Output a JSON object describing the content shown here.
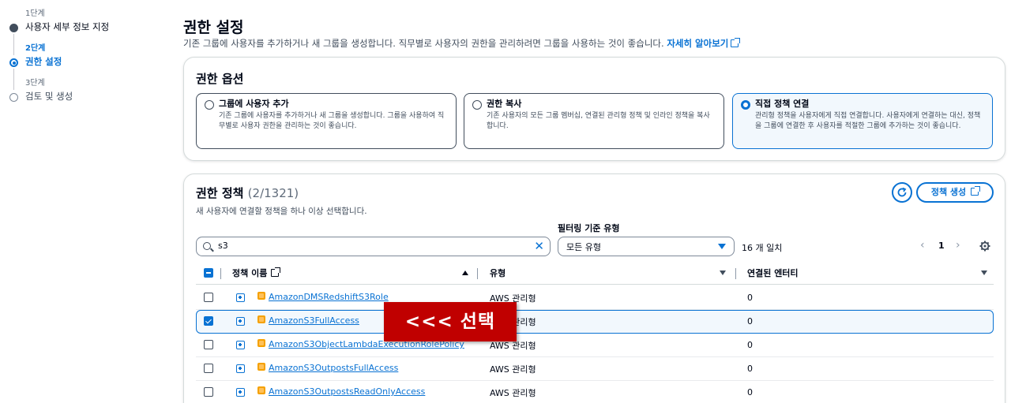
{
  "steps": [
    {
      "num": "1단계",
      "label": "사용자 세부 정보 지정"
    },
    {
      "num": "2단계",
      "label": "권한 설정"
    },
    {
      "num": "3단계",
      "label": "검토 및 생성"
    }
  ],
  "page": {
    "title": "권한 설정",
    "description": "기존 그룹에 사용자를 추가하거나 새 그룹을 생성합니다. 직무별로 사용자의 권한을 관리하려면 그룹을 사용하는 것이 좋습니다.",
    "learn_more": "자세히 알아보기"
  },
  "options": {
    "title": "권한 옵션",
    "items": [
      {
        "title": "그룹에 사용자 추가",
        "desc": "기존 그룹에 사용자를 추가하거나 새 그룹을 생성합니다. 그룹을 사용하여 직무별로 사용자 권한을 관리하는 것이 좋습니다."
      },
      {
        "title": "권한 복사",
        "desc": "기존 사용자의 모든 그룹 멤버십, 연결된 관리형 정책 및 인라인 정책을 복사합니다."
      },
      {
        "title": "직접 정책 연결",
        "desc": "관리형 정책을 사용자에게 직접 연결합니다. 사용자에게 연결하는 대신, 정책을 그룹에 연결한 후 사용자를 적절한 그룹에 추가하는 것이 좋습니다."
      }
    ]
  },
  "policies": {
    "title": "권한 정책",
    "count": "(2/1321)",
    "description": "새 사용자에 연결할 정책을 하나 이상 선택합니다.",
    "create_button": "정책 생성",
    "filter_label": "필터링 기준 유형",
    "search_value": "s3",
    "filter_value": "모든 유형",
    "match_text": "16 개 일치",
    "page_number": "1",
    "columns": {
      "name": "정책 이름",
      "type": "유형",
      "attached": "연결된 엔터티"
    },
    "rows": [
      {
        "name": "AmazonDMSRedshiftS3Role",
        "type": "AWS 관리형",
        "attached": "0"
      },
      {
        "name": "AmazonS3FullAccess",
        "type": "AWS 관리형",
        "attached": "0"
      },
      {
        "name": "AmazonS3ObjectLambdaExecutionRolePolicy",
        "type": "AWS 관리형",
        "attached": "0"
      },
      {
        "name": "AmazonS3OutpostsFullAccess",
        "type": "AWS 관리형",
        "attached": "0"
      },
      {
        "name": "AmazonS3OutpostsReadOnlyAccess",
        "type": "AWS 관리형",
        "attached": "0"
      }
    ]
  },
  "annotation": "<<< 선택"
}
